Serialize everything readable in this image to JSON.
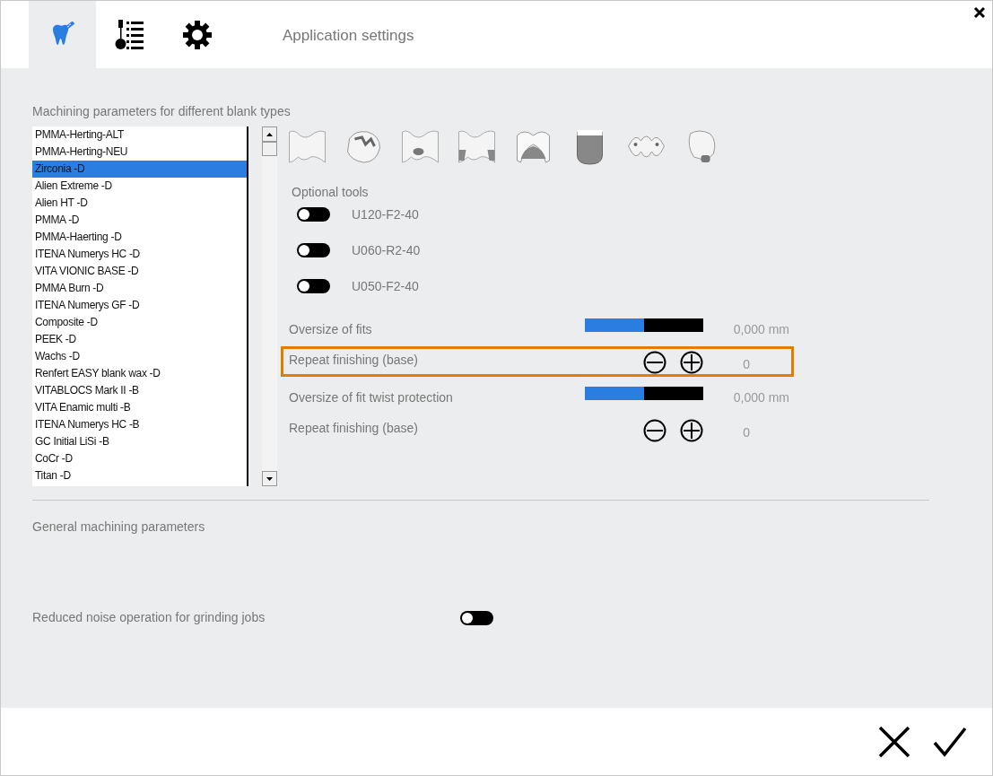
{
  "tabs": [
    {
      "kind": "tooth",
      "selected": true
    },
    {
      "kind": "toollist",
      "selected": false
    },
    {
      "kind": "gear",
      "selected": false
    }
  ],
  "header_title": "Application settings",
  "blank_section": {
    "title": "Machining parameters for different blank types",
    "blanks": [
      {
        "label": "PMMA-Herting-ALT",
        "selected": false
      },
      {
        "label": "PMMA-Herting-NEU",
        "selected": false
      },
      {
        "label": "Zirconia -D",
        "selected": true
      },
      {
        "label": "Alien Extreme -D",
        "selected": false
      },
      {
        "label": "Alien HT -D",
        "selected": false
      },
      {
        "label": "PMMA -D",
        "selected": false
      },
      {
        "label": "PMMA-Haerting -D",
        "selected": false
      },
      {
        "label": "ITENA Numerys HC -D",
        "selected": false
      },
      {
        "label": "VITA VIONIC BASE -D",
        "selected": false
      },
      {
        "label": "PMMA Burn -D",
        "selected": false
      },
      {
        "label": "ITENA Numerys GF -D",
        "selected": false
      },
      {
        "label": "Composite -D",
        "selected": false
      },
      {
        "label": "PEEK -D",
        "selected": false
      },
      {
        "label": "Wachs -D",
        "selected": false
      },
      {
        "label": "Renfert EASY blank wax -D",
        "selected": false
      },
      {
        "label": "VITABLOCS Mark II -B",
        "selected": false
      },
      {
        "label": "VITA Enamic multi -B",
        "selected": false
      },
      {
        "label": "ITENA Numerys HC -B",
        "selected": false
      },
      {
        "label": "GC Initial LiSi -B",
        "selected": false
      },
      {
        "label": "CoCr -D",
        "selected": false
      },
      {
        "label": "Titan -D",
        "selected": false
      }
    ],
    "optional_tools_title": "Optional tools",
    "optional_tools": [
      {
        "label": "U120-F2-40",
        "on": false
      },
      {
        "label": "U060-R2-40",
        "on": false
      },
      {
        "label": "U050-F2-40",
        "on": false
      }
    ],
    "parameters": [
      {
        "kind": "slider",
        "label": "Oversize of fits",
        "level": 0.5,
        "reading": "0,000 mm",
        "highlighted": false
      },
      {
        "kind": "stepper",
        "label": "Repeat finishing (base)",
        "reading": "0",
        "highlighted": true
      },
      {
        "kind": "slider",
        "label": "Oversize of fit twist protection",
        "level": 0.5,
        "reading": "0,000 mm",
        "highlighted": false
      },
      {
        "kind": "stepper",
        "label": "Repeat finishing (base)",
        "reading": "0",
        "highlighted": false
      }
    ]
  },
  "general_section": {
    "title": "General machining parameters",
    "settings": [
      {
        "label": "Reduced noise operation for grinding jobs",
        "on": false
      }
    ]
  }
}
